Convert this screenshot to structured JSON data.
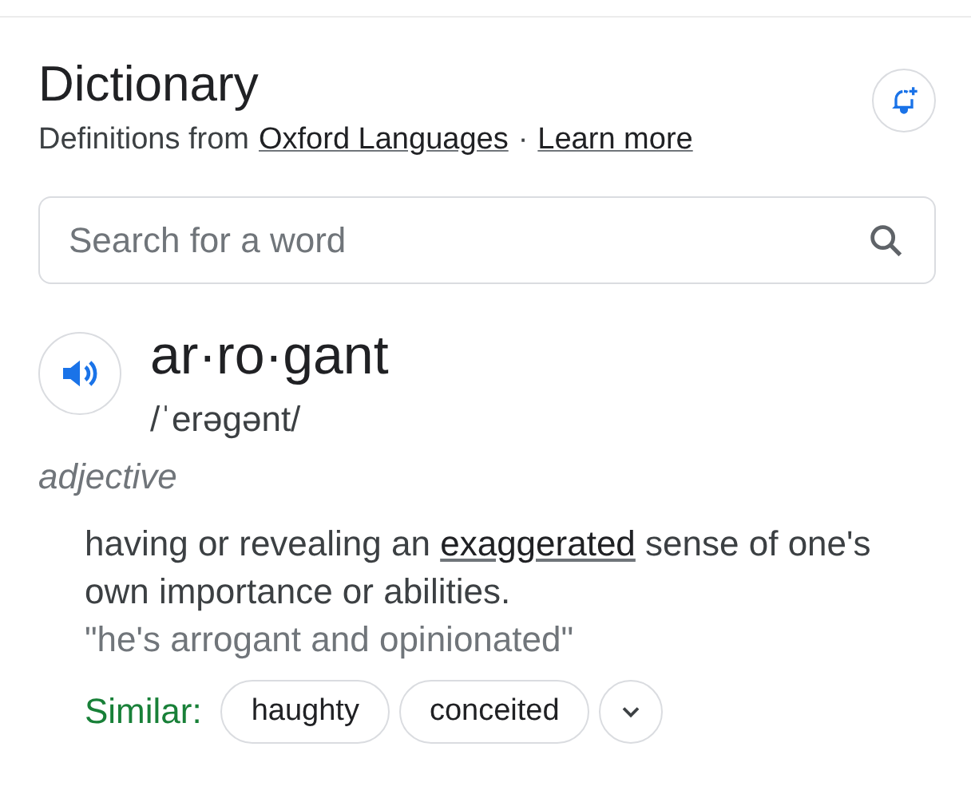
{
  "header": {
    "title": "Dictionary",
    "source_prefix": "Definitions from",
    "source_link": "Oxford Languages",
    "separator": "·",
    "learn_more": "Learn more"
  },
  "search": {
    "placeholder": "Search for a word"
  },
  "entry": {
    "word": "ar·ro·gant",
    "phonetic": "/ˈerəɡənt/",
    "part_of_speech": "adjective",
    "definition": {
      "before": "having or revealing an",
      "link": "exaggerated",
      "after": "sense of one's own importance or abilities."
    },
    "example": "\"he's arrogant and opinionated\"",
    "similar_label": "Similar:",
    "similar": [
      "haughty",
      "conceited"
    ]
  }
}
